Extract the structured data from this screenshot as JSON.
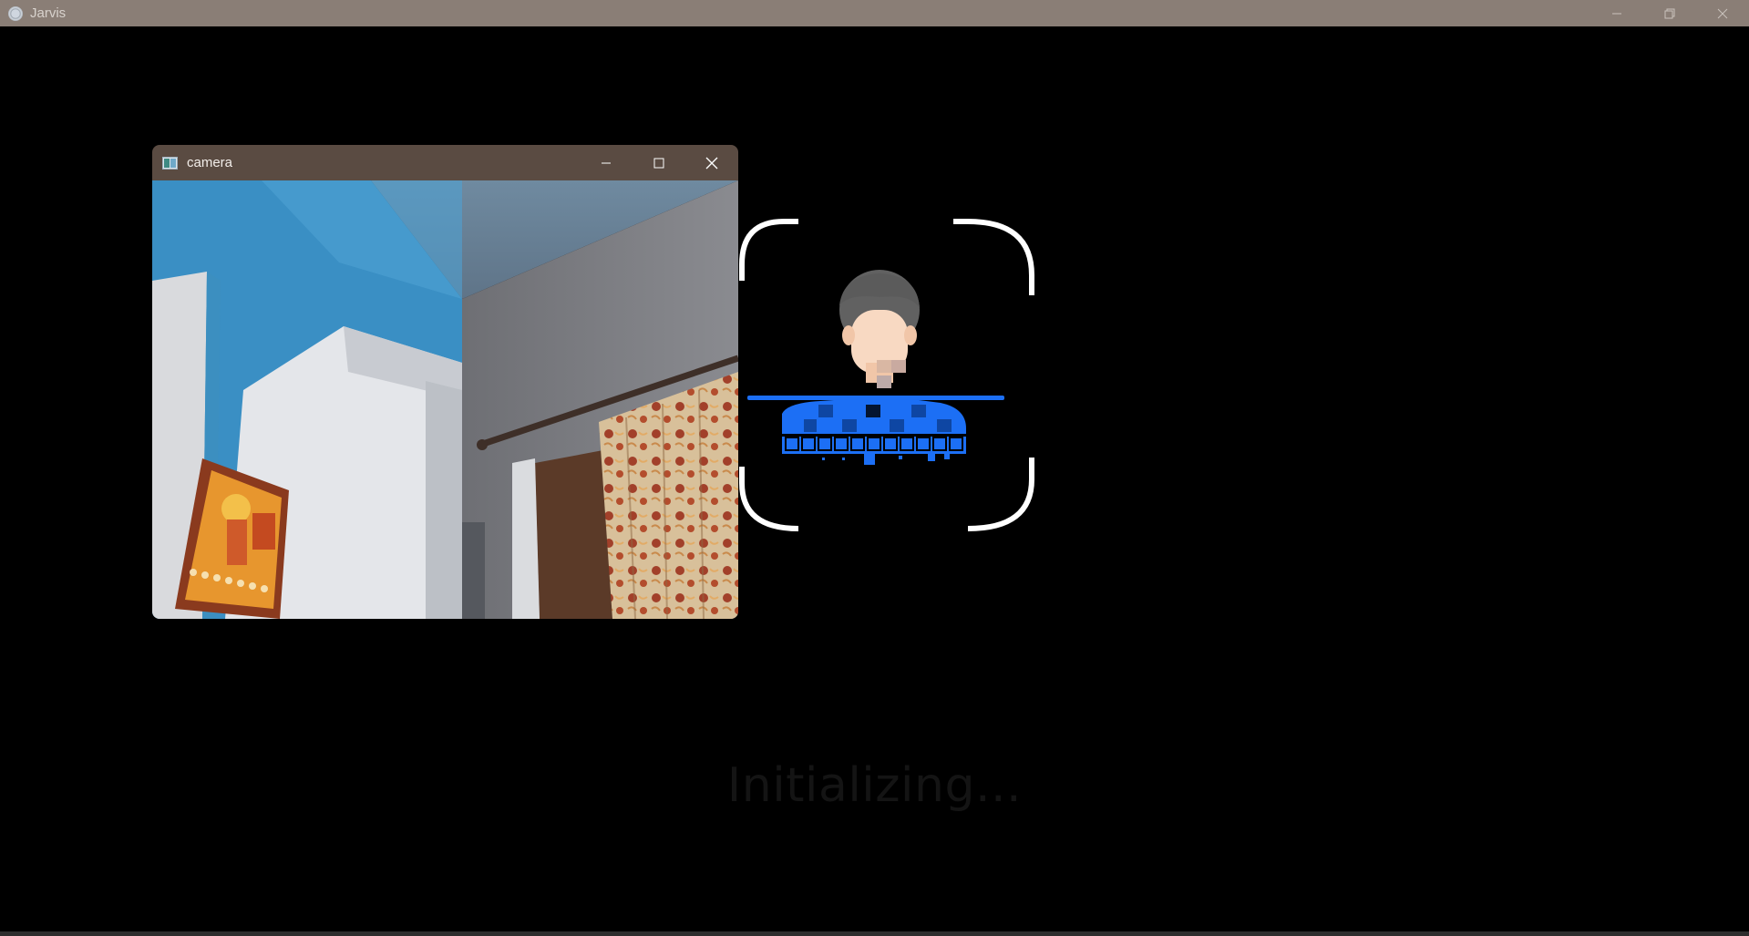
{
  "window": {
    "title": "Jarvis",
    "icon": "app-icon",
    "controls": [
      "minimize-icon",
      "restore-icon",
      "close-icon"
    ]
  },
  "camera_window": {
    "title": "camera",
    "icon": "camera-window-icon",
    "controls": [
      "minimize-icon",
      "maximize-icon",
      "close-icon"
    ]
  },
  "face_scan": {
    "icon": "face-scan-icon",
    "accent_color": "#1c6ff5",
    "bracket_color": "#ffffff"
  },
  "status": {
    "text": "Initializing..."
  },
  "colors": {
    "background": "#000000",
    "titlebar": "#8a7e76",
    "camera_titlebar": "#5a4b42"
  }
}
